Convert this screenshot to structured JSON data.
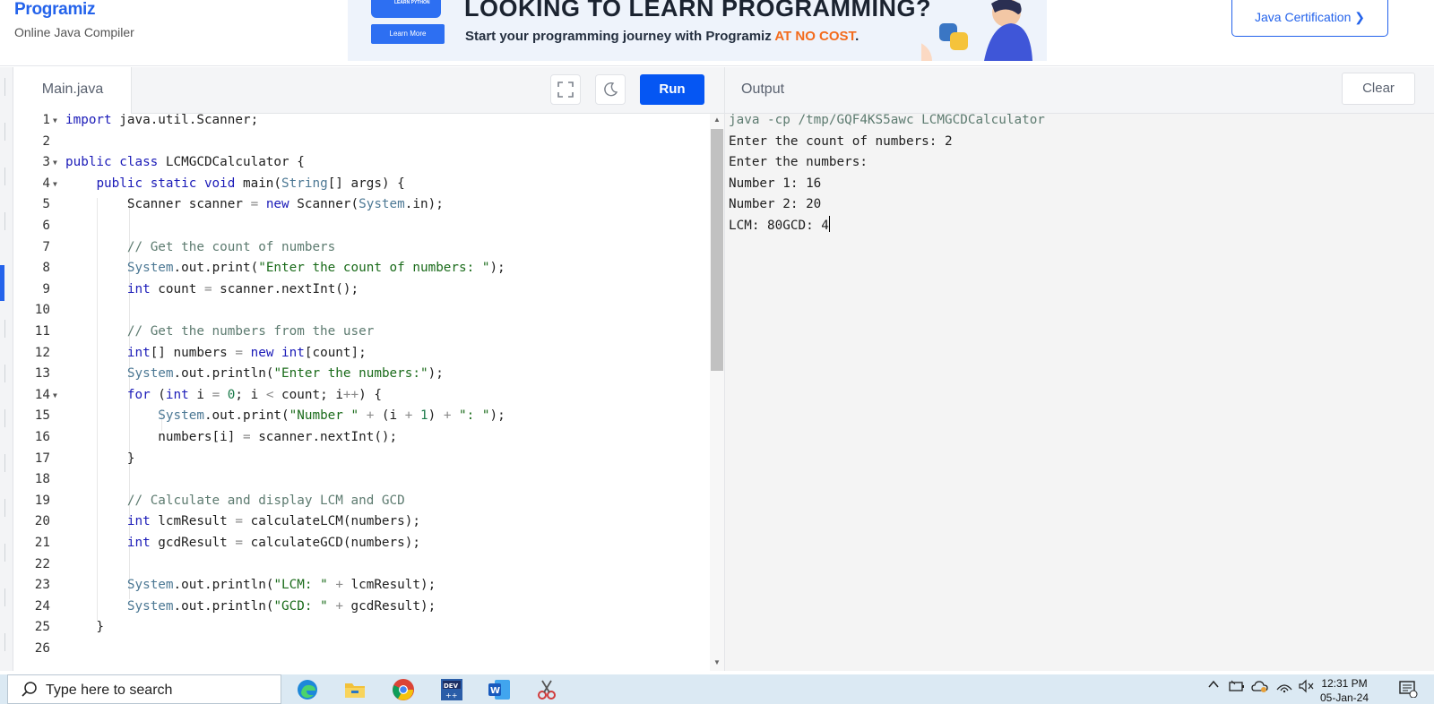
{
  "header": {
    "logo": "Programiz",
    "subtitle": "Online Java Compiler",
    "banner": {
      "badge": "LEARN PYTHON",
      "button": "Learn More",
      "headline": "LOOKING TO LEARN PROGRAMMING?",
      "subline_start": "Start your programming journey with Programiz ",
      "subline_accent": "AT NO COST",
      "subline_end": "."
    },
    "cert_button": "Java Certification ❯"
  },
  "editor": {
    "file_tab": "Main.java",
    "run_label": "Run",
    "lines": [
      "1",
      "2",
      "3",
      "4",
      "5",
      "6",
      "7",
      "8",
      "9",
      "10",
      "11",
      "12",
      "13",
      "14",
      "15",
      "16",
      "17",
      "18",
      "19",
      "20",
      "21",
      "22",
      "23",
      "24",
      "25",
      "26"
    ]
  },
  "output": {
    "title": "Output",
    "clear_label": "Clear",
    "lines": [
      "java -cp /tmp/GQF4KS5awc LCMGCDCalculator",
      "Enter the count of numbers: 2",
      "Enter the numbers:",
      "Number 1: 16",
      "Number 2: 20",
      "LCM: 80GCD: 4"
    ]
  },
  "taskbar": {
    "search_placeholder": "Type here to search",
    "apps": [
      "edge-icon",
      "file-explorer-icon",
      "chrome-icon",
      "dev-cpp-icon",
      "word-icon",
      "snipping-tool-icon"
    ],
    "time": "12:31 PM",
    "date": "05-Jan-24"
  },
  "colors": {
    "accent": "#0556f3",
    "brand": "#2463eb",
    "banner_accent": "#f36b1c",
    "output_bg": "#f4f4f4"
  }
}
